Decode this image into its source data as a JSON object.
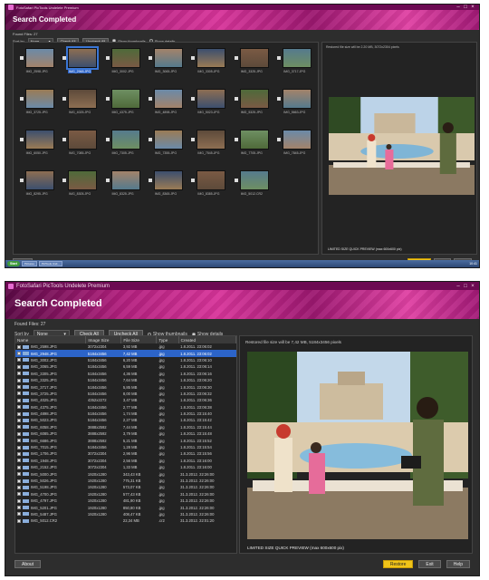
{
  "app": {
    "window_title": "FotoSafari PicTools Undelete Premium",
    "header_title": "Search Completed"
  },
  "colors": {
    "accent_magenta": "#b4207f",
    "selection_blue": "#2c64c8",
    "restore_yellow": "#f0c419",
    "window_bg": "#2d2d2d"
  },
  "icons": {
    "titlebar": [
      "minimize-icon",
      "maximize-icon",
      "close-icon"
    ],
    "file": "image-file-icon",
    "checkbox": "checkbox-checked-icon"
  },
  "top_window": {
    "found_files": "Found Files: 27",
    "sort_by_label": "Sort by",
    "sort_by_value": "None",
    "check_all": "Check All",
    "uncheck_all": "Uncheck All",
    "show_thumbnails": "Show thumbnails",
    "show_details": "Show details",
    "preview_info": "Restored file size will be 2.20 MB, 3072x2304 pixels",
    "preview_caption": "LIMITED SIZE QUICK PREVIEW (max 600x600 pix)",
    "about": "About",
    "restore": "Restore",
    "exit": "Exit",
    "help": "Help",
    "thumbnails": [
      {
        "label": "IMG_2598.JPG"
      },
      {
        "label": "IMG_2948.JPG"
      },
      {
        "label": "IMG_3002.JPG"
      },
      {
        "label": "IMG_3065.JPG"
      },
      {
        "label": "IMG_3305.JPG"
      },
      {
        "label": "IMG_3325.JPG"
      },
      {
        "label": "IMG_3717.JPG"
      },
      {
        "label": "IMG_3725.JPG"
      },
      {
        "label": "IMG_4025.JPG"
      },
      {
        "label": "IMG_4375.JPG"
      },
      {
        "label": "IMG_4898.JPG"
      },
      {
        "label": "IMG_5023.JPG"
      },
      {
        "label": "IMG_5325.JPG"
      },
      {
        "label": "IMG_5663.JPG"
      },
      {
        "label": "IMG_6050.JPG"
      },
      {
        "label": "IMG_7085.JPG"
      },
      {
        "label": "IMG_7305.JPG"
      },
      {
        "label": "IMG_7355.JPG"
      },
      {
        "label": "IMG_7545.JPG"
      },
      {
        "label": "IMG_7705.JPG"
      },
      {
        "label": "IMG_7845.JPG"
      },
      {
        "label": "IMG_8295.JPG"
      },
      {
        "label": "IMG_8305.JPG"
      },
      {
        "label": "IMG_8325.JPG"
      },
      {
        "label": "IMG_8365.JPG"
      },
      {
        "label": "IMG_8385.JPG"
      },
      {
        "label": "IMG_5012.CR2"
      }
    ],
    "taskbar": {
      "start": "Start",
      "tasks": [
        "Pictures",
        "PicTools Und..."
      ],
      "clock": "10:41"
    }
  },
  "bottom_window": {
    "found_files": "Found Files: 27",
    "sort_by_label": "Sort by",
    "sort_by_value": "None",
    "check_all": "Check All",
    "uncheck_all": "Uncheck All",
    "show_thumbnails": "Show thumbnails",
    "show_details": "Show details",
    "columns": [
      "Name",
      "Image Size",
      "File Size",
      "Type",
      "Created"
    ],
    "rows": [
      [
        "IMG_2598.JPG",
        "3072x2304",
        "3,92 MB",
        ".jpg",
        "1.8.2011. 23:06:02"
      ],
      [
        "IMG_2948.JPG",
        "5184x3456",
        "7,42 MB",
        ".jpg",
        "1.8.2011. 23:06:02"
      ],
      [
        "IMG_3002.JPG",
        "5184x3456",
        "6,20 MB",
        ".jpg",
        "1.8.2011. 23:06:10"
      ],
      [
        "IMG_3065.JPG",
        "5184x3456",
        "6,59 MB",
        ".jpg",
        "1.8.2011. 23:06:14"
      ],
      [
        "IMG_3305.JPG",
        "5184x3456",
        "4,36 MB",
        ".jpg",
        "1.8.2011. 23:06:16"
      ],
      [
        "IMG_3325.JPG",
        "5184x3456",
        "7,64 MB",
        ".jpg",
        "1.8.2011. 23:06:20"
      ],
      [
        "IMG_3717.JPG",
        "5184x3456",
        "5,85 MB",
        ".jpg",
        "1.8.2011. 23:06:30"
      ],
      [
        "IMG_3725.JPG",
        "5184x3456",
        "8,00 MB",
        ".jpg",
        "1.8.2011. 23:06:32"
      ],
      [
        "IMG_4025.JPG",
        "4352x2272",
        "3,47 MB",
        ".jpg",
        "1.8.2011. 23:06:36"
      ],
      [
        "IMG_4375.JPG",
        "5184x3456",
        "2,77 MB",
        ".jpg",
        "1.8.2011. 23:06:38"
      ],
      [
        "IMG_4898.JPG",
        "5184x3456",
        "1,74 MB",
        ".jpg",
        "1.8.2011. 23:15:40"
      ],
      [
        "IMG_5023.JPG",
        "5184x3456",
        "2,27 MB",
        ".jpg",
        "1.8.2011. 23:15:42"
      ],
      [
        "IMG_6058.JPG",
        "3888x2592",
        "7,44 MB",
        ".jpg",
        "1.8.2011. 23:15:44"
      ],
      [
        "IMG_6085.JPG",
        "3888x2592",
        "3,79 MB",
        ".jpg",
        "1.8.2011. 23:15:48"
      ],
      [
        "IMG_6686.JPG",
        "3888x2592",
        "5,21 MB",
        ".jpg",
        "1.8.2011. 23:15:52"
      ],
      [
        "IMG_7015.JPG",
        "5184x3456",
        "1,28 MB",
        ".jpg",
        "1.8.2011. 23:15:54"
      ],
      [
        "IMG_1706.JPG",
        "3072x2304",
        "2,96 MB",
        ".jpg",
        "1.8.2011. 23:15:56"
      ],
      [
        "IMG_1948.JPG",
        "3072x2304",
        "2,56 MB",
        ".jpg",
        "1.8.2011. 23:16:00"
      ],
      [
        "IMG_2152.JPG",
        "3072x2304",
        "1,33 MB",
        ".jpg",
        "1.8.2011. 23:16:00"
      ],
      [
        "IMG_5000.JPG",
        "1920x1280",
        "343,43 KB",
        ".jpg",
        "31.3.2012. 22:26:00"
      ],
      [
        "IMG_5026.JPG",
        "1920x1280",
        "775,31 KB",
        ".jpg",
        "31.3.2012. 22:26:00"
      ],
      [
        "IMG_5198.JPG",
        "1920x1280",
        "573,07 KB",
        ".jpg",
        "31.3.2012. 22:26:00"
      ],
      [
        "IMG_4700.JPG",
        "1920x1280",
        "577,43 KB",
        ".jpg",
        "31.3.2012. 22:26:00"
      ],
      [
        "IMG_4797.JPG",
        "1920x1280",
        "481,90 KB",
        ".jpg",
        "31.3.2012. 22:26:00"
      ],
      [
        "IMG_5201.JPG",
        "1920x1280",
        "850,80 KB",
        ".jpg",
        "31.3.2012. 22:26:00"
      ],
      [
        "IMG_5487.JPG",
        "1920x1280",
        "408,47 KB",
        ".jpg",
        "31.3.2012. 22:26:00"
      ],
      [
        "IMG_5012.CR2",
        "",
        "22,34 MB",
        ".cr2",
        "31.3.2012. 22:01:20"
      ]
    ],
    "selected_row": 1,
    "preview_info": "Restored file size will be 7,42 MB, 5184x3456 pixels",
    "preview_caption": "LIMITED SIZE QUICK PREVIEW (max 600x600 pix)",
    "about": "About",
    "restore": "Restore",
    "exit": "Exit",
    "help": "Help"
  }
}
